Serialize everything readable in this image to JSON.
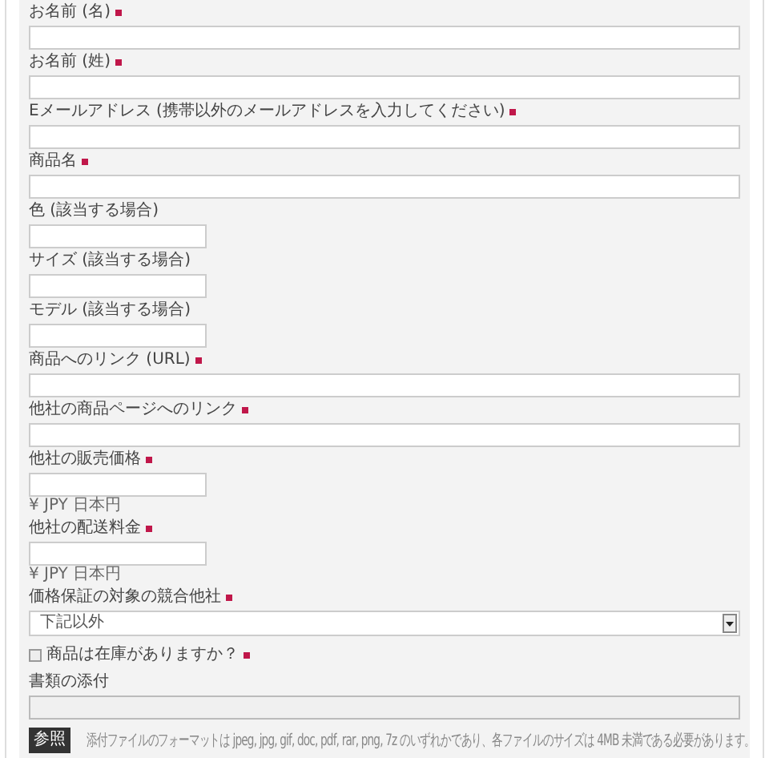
{
  "fields": [
    {
      "kind": "wide",
      "label": "お名前 (名)",
      "required": true
    },
    {
      "kind": "wide",
      "label": "お名前 (姓)",
      "required": true
    },
    {
      "kind": "wide",
      "label": "Eメールアドレス (携帯以外のメールアドレスを入力してください)",
      "required": true
    },
    {
      "kind": "wide",
      "label": "商品名",
      "required": true
    },
    {
      "kind": "short",
      "label": "色 (該当する場合)",
      "required": false
    },
    {
      "kind": "short",
      "label": "サイズ (該当する場合)",
      "required": false
    },
    {
      "kind": "short",
      "label": "モデル (該当する場合)",
      "required": false
    },
    {
      "kind": "wide",
      "label": "商品へのリンク (URL)",
      "required": true
    },
    {
      "kind": "wide",
      "label": "他社の商品ページへのリンク",
      "required": true
    },
    {
      "kind": "short",
      "label": "他社の販売価格",
      "required": true,
      "note": "¥ JPY 日本円"
    },
    {
      "kind": "short",
      "label": "他社の配送料金",
      "required": true,
      "note": "¥ JPY 日本円"
    },
    {
      "kind": "select",
      "label": "価格保証の対象の競合他社",
      "required": true,
      "value": "下記以外"
    },
    {
      "kind": "checkbox",
      "label": "商品は在庫がありますか？",
      "required": true,
      "checked": false
    },
    {
      "kind": "file",
      "label": "書類の添付",
      "required": false,
      "button": "参照",
      "note": "添付ファイルのフォーマットは jpeg, jpg, gif, doc, pdf, rar, png, 7z のいずれかであり、各ファイルのサイズは 4MB 未満である必要があります。"
    }
  ]
}
